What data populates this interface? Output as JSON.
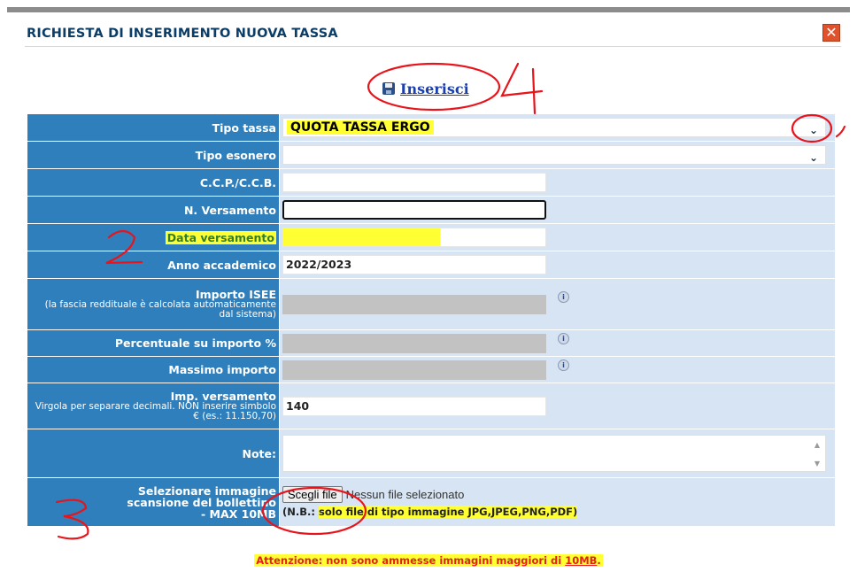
{
  "dialog": {
    "title": "RICHIESTA DI INSERIMENTO NUOVA TASSA",
    "close_glyph": "✕"
  },
  "insert": {
    "label": "Inserisci",
    "icon": "floppy-disk-icon"
  },
  "form": {
    "tipo_tassa": {
      "label": "Tipo tassa",
      "value": "QUOTA TASSA ERGO"
    },
    "tipo_esonero": {
      "label": "Tipo esonero",
      "value": ""
    },
    "ccp": {
      "label": "C.C.P./C.C.B.",
      "value": ""
    },
    "n_versamento": {
      "label": "N. Versamento",
      "value": ""
    },
    "data_versamento": {
      "label": "Data versamento",
      "value": ""
    },
    "anno_accademico": {
      "label": "Anno accademico",
      "value": "2022/2023"
    },
    "importo_isee": {
      "label": "Importo ISEE",
      "sub": "(la fascia reddituale è calcolata automaticamente dal sistema)",
      "value": ""
    },
    "percentuale": {
      "label": "Percentuale su importo %",
      "value": ""
    },
    "massimo": {
      "label": "Massimo importo",
      "value": ""
    },
    "imp_versamento": {
      "label": "Imp. versamento",
      "sub": "Virgola per separare decimali. NON inserire simbolo € (es.: 11.150,70)",
      "value": "140"
    },
    "note": {
      "label": "Note:",
      "value": ""
    },
    "file": {
      "label_line1": "Selezionare immagine",
      "label_line2": "scansione del bollettino",
      "label_line3": "- MAX 10MB",
      "button": "Scegli file",
      "status": "Nessun file selezionato",
      "note_prefix": "(N.B.: ",
      "note_body": "solo file di tipo immagine JPG,JPEG,PNG,PDF)"
    }
  },
  "warning": {
    "prefix": "Attenzione: non sono ammesse immagini maggiori di ",
    "size": "10MB",
    "suffix": "."
  },
  "annotations": {
    "n1": "1",
    "n2": "2",
    "n3": "3",
    "n4": "4",
    "color": "#e8141c"
  },
  "colors": {
    "label_bg": "#2f7fbc",
    "field_bg": "#d6e4f3",
    "highlight": "#ffff33",
    "warning": "#e4201a"
  }
}
